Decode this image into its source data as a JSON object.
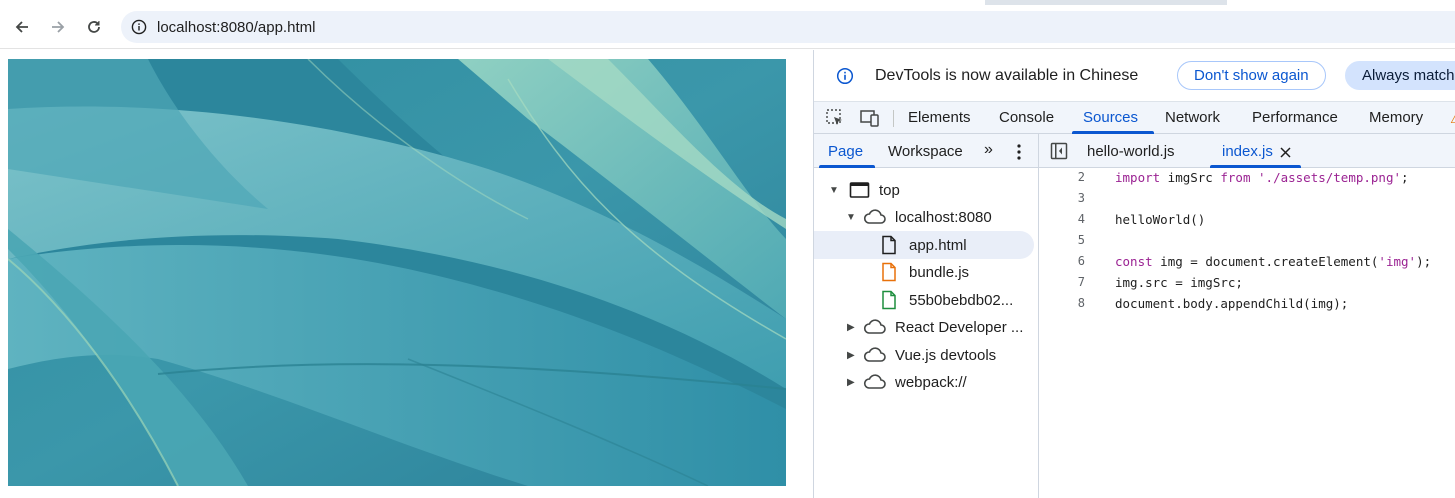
{
  "browser": {
    "url": "localhost:8080/app.html"
  },
  "devtools": {
    "infobar": {
      "message": "DevTools is now available in Chinese",
      "dont_show_label": "Don't show again",
      "always_match_label": "Always match"
    },
    "main_tabs": [
      "Elements",
      "Console",
      "Sources",
      "Network",
      "Performance",
      "Memory"
    ],
    "active_main_tab": "Sources",
    "navigator_tabs": [
      "Page",
      "Workspace"
    ],
    "active_navigator_tab": "Page",
    "editor_tabs": [
      "hello-world.js",
      "index.js"
    ],
    "active_editor_tab": "index.js",
    "tree": [
      {
        "label": "top",
        "depth": 0,
        "expanded": true,
        "icon": "frame-icon"
      },
      {
        "label": "localhost:8080",
        "depth": 1,
        "expanded": true,
        "icon": "cloud-icon"
      },
      {
        "label": "app.html",
        "depth": 2,
        "icon": "document-icon",
        "selected": true
      },
      {
        "label": "bundle.js",
        "depth": 2,
        "icon": "script-file-icon"
      },
      {
        "label": "55b0bebdb02...",
        "depth": 2,
        "icon": "image-file-icon"
      },
      {
        "label": "React Developer ...",
        "depth": 1,
        "expanded": false,
        "icon": "cloud-icon"
      },
      {
        "label": "Vue.js devtools",
        "depth": 1,
        "expanded": false,
        "icon": "cloud-icon"
      },
      {
        "label": "webpack://",
        "depth": 1,
        "expanded": false,
        "icon": "cloud-icon"
      }
    ],
    "code": [
      {
        "line": "2",
        "text": "import imgSrc from './assets/temp.png';"
      },
      {
        "line": "3",
        "text": ""
      },
      {
        "line": "4",
        "text": "helloWorld()"
      },
      {
        "line": "5",
        "text": ""
      },
      {
        "line": "6",
        "text": "const img = document.createElement('img');"
      },
      {
        "line": "7",
        "text": "img.src = imgSrc;"
      },
      {
        "line": "8",
        "text": "document.body.appendChild(img);"
      }
    ]
  },
  "colors": {
    "accent": "#0b57d0",
    "toolbar_bg": "#f1f5fb",
    "omnibox_bg": "#edf2fa",
    "keyword": "#9b2393",
    "script_icon": "#e8710a",
    "image_icon": "#1e8e3e"
  }
}
